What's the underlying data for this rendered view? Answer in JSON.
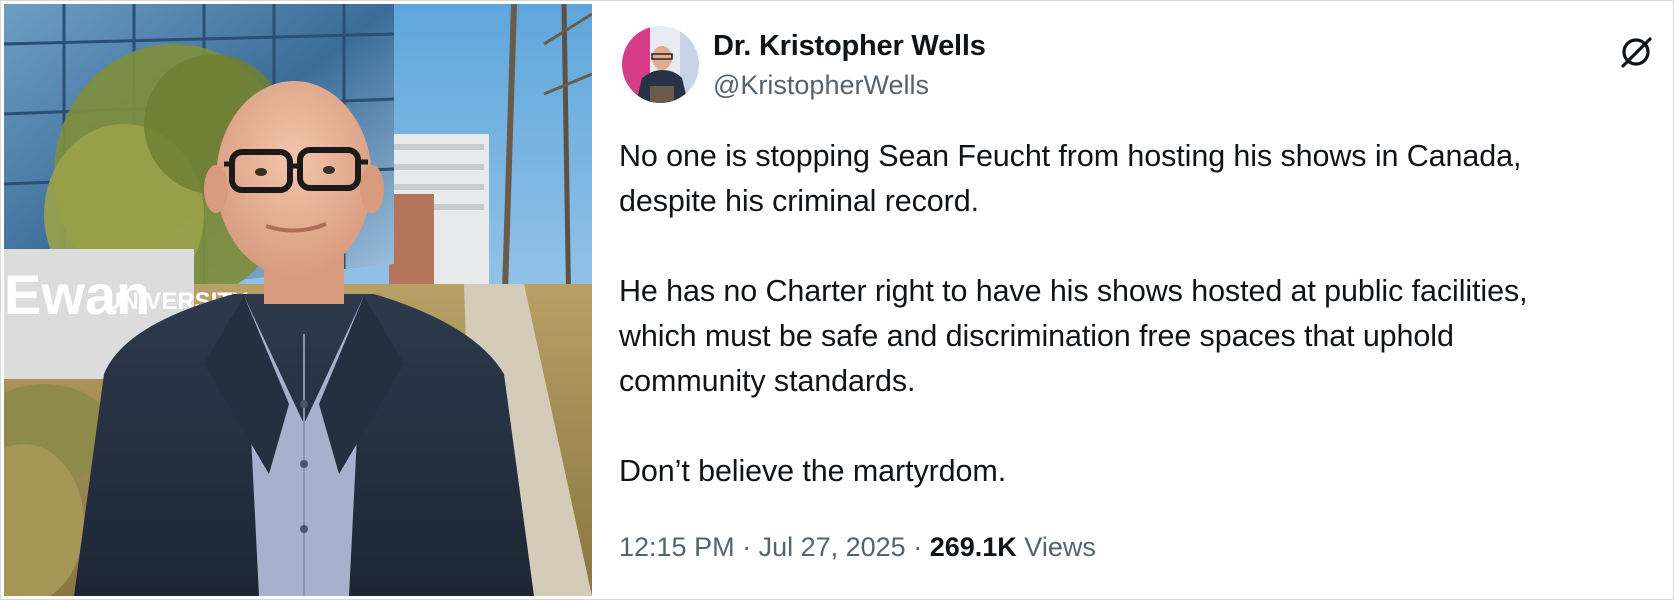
{
  "photo": {
    "sign_text": "Ewan UNIVERSITY",
    "subject": "man in dark blazer and glasses outdoors"
  },
  "tweet": {
    "author": {
      "display_name": "Dr. Kristopher Wells",
      "handle": "@KristopherWells"
    },
    "paragraphs": [
      {
        "lines": [
          "No one is stopping Sean Feucht from hosting his shows in Canada,",
          "despite his criminal record."
        ]
      },
      {
        "lines": [
          "He has no Charter right to have his shows hosted at public facilities,",
          "which must be safe and discrimination free spaces that uphold",
          "community standards."
        ]
      },
      {
        "lines": [
          "Don’t believe the martyrdom."
        ]
      }
    ],
    "meta": {
      "time": "12:15 PM",
      "separator": " · ",
      "date": "Jul 27, 2025",
      "views_count": "269.1K",
      "views_label": "Views"
    },
    "icons": {
      "platform": "x-logo-icon"
    }
  },
  "colors": {
    "text_primary": "#0f1419",
    "text_secondary": "#536471"
  }
}
